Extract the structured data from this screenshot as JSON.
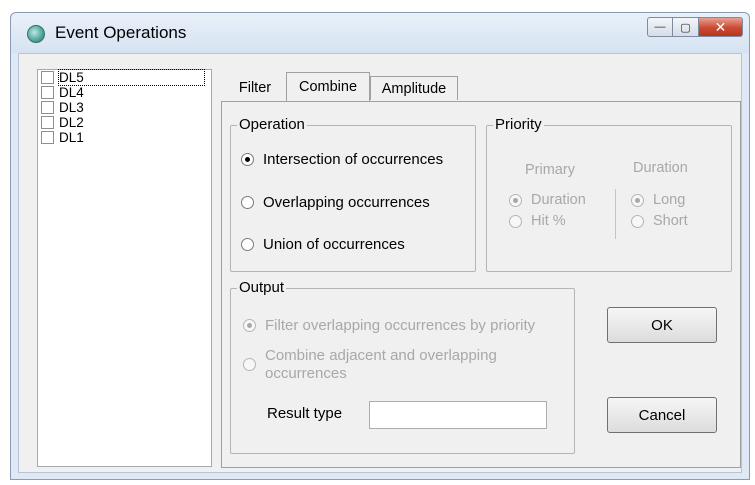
{
  "window": {
    "title": "Event Operations",
    "minimize_glyph": "—",
    "maximize_glyph": "▢",
    "close_glyph": "✕"
  },
  "list": {
    "items": [
      {
        "label": "DL5",
        "checked": false,
        "focused": true
      },
      {
        "label": "DL4",
        "checked": false
      },
      {
        "label": "DL3",
        "checked": false
      },
      {
        "label": "DL2",
        "checked": false
      },
      {
        "label": "DL1",
        "checked": false
      }
    ]
  },
  "tabs": [
    {
      "label": "Filter",
      "active": false
    },
    {
      "label": "Combine",
      "active": true
    },
    {
      "label": "Amplitude",
      "active": false
    }
  ],
  "operation": {
    "title": "Operation",
    "options": [
      {
        "label": "Intersection of occurrences",
        "checked": true
      },
      {
        "label": "Overlapping occurrences",
        "checked": false
      },
      {
        "label": "Union of occurrences",
        "checked": false
      }
    ]
  },
  "priority": {
    "title": "Priority",
    "primary_header": "Primary",
    "duration_header": "Duration",
    "primary_options": [
      {
        "label": "Duration",
        "checked": true
      },
      {
        "label": "Hit %",
        "checked": false
      }
    ],
    "duration_options": [
      {
        "label": "Long",
        "checked": true
      },
      {
        "label": "Short",
        "checked": false
      }
    ]
  },
  "output": {
    "title": "Output",
    "options": [
      {
        "label": "Filter overlapping occurrences by priority",
        "checked": true
      },
      {
        "label_line1": "Combine adjacent and overlapping",
        "label_line2": "occurrences",
        "checked": false
      }
    ],
    "result_type_label": "Result type",
    "result_type_value": ""
  },
  "buttons": {
    "ok": "OK",
    "cancel": "Cancel"
  }
}
